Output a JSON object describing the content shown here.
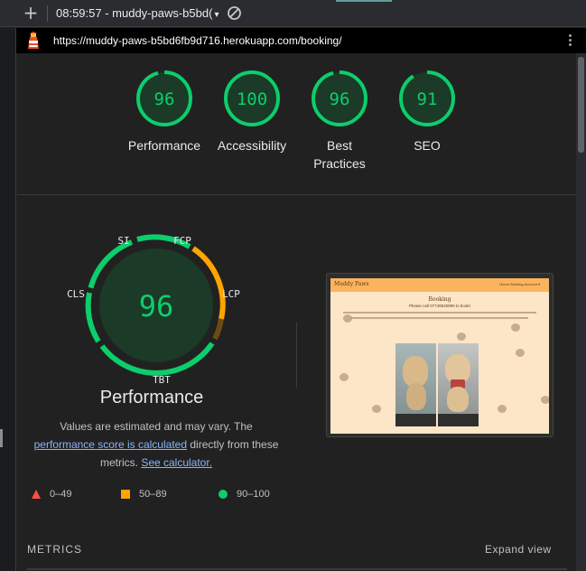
{
  "topbar": {
    "new_tab_label": "+",
    "report_select": "08:59:57 - muddy-paws-b5bd(",
    "caret": "▾"
  },
  "urlbar": {
    "url": "https://muddy-paws-b5bd6fb9d716.herokuapp.com/booking/"
  },
  "scores": [
    {
      "value": "96",
      "label": "Performance",
      "fraction": 0.96
    },
    {
      "value": "100",
      "label": "Accessibility",
      "fraction": 1.0
    },
    {
      "value": "96",
      "label": "Best Practices",
      "fraction": 0.96
    },
    {
      "value": "91",
      "label": "SEO",
      "fraction": 0.91
    }
  ],
  "performance": {
    "score": "96",
    "title": "Performance",
    "metric_labels": {
      "si": "SI",
      "fcp": "FCP",
      "lcp": "LCP",
      "tbt": "TBT",
      "cls": "CLS"
    },
    "note_prefix": "Values are estimated and may vary. The",
    "note_link1": "performance score is calculated",
    "note_middle": "directly from these",
    "note_metrics": "metrics.",
    "note_link2": "See calculator."
  },
  "legend": [
    {
      "shape": "triangle",
      "range": "0–49",
      "color": "#ff4e42"
    },
    {
      "shape": "square",
      "range": "50–89",
      "color": "#ffa400"
    },
    {
      "shape": "circle",
      "range": "90–100",
      "color": "#0cce6b"
    }
  ],
  "screenshot_page": {
    "brand": "Muddy Paws",
    "nav": "Home   Booking   Account ▾",
    "heading": "Booking",
    "subheading": "Please call 07749525990 to book!"
  },
  "metrics": {
    "label": "METRICS",
    "expand": "Expand view"
  },
  "colors": {
    "good": "#0cce6b",
    "average": "#ffa400",
    "poor": "#ff4e42",
    "background": "#212122"
  }
}
